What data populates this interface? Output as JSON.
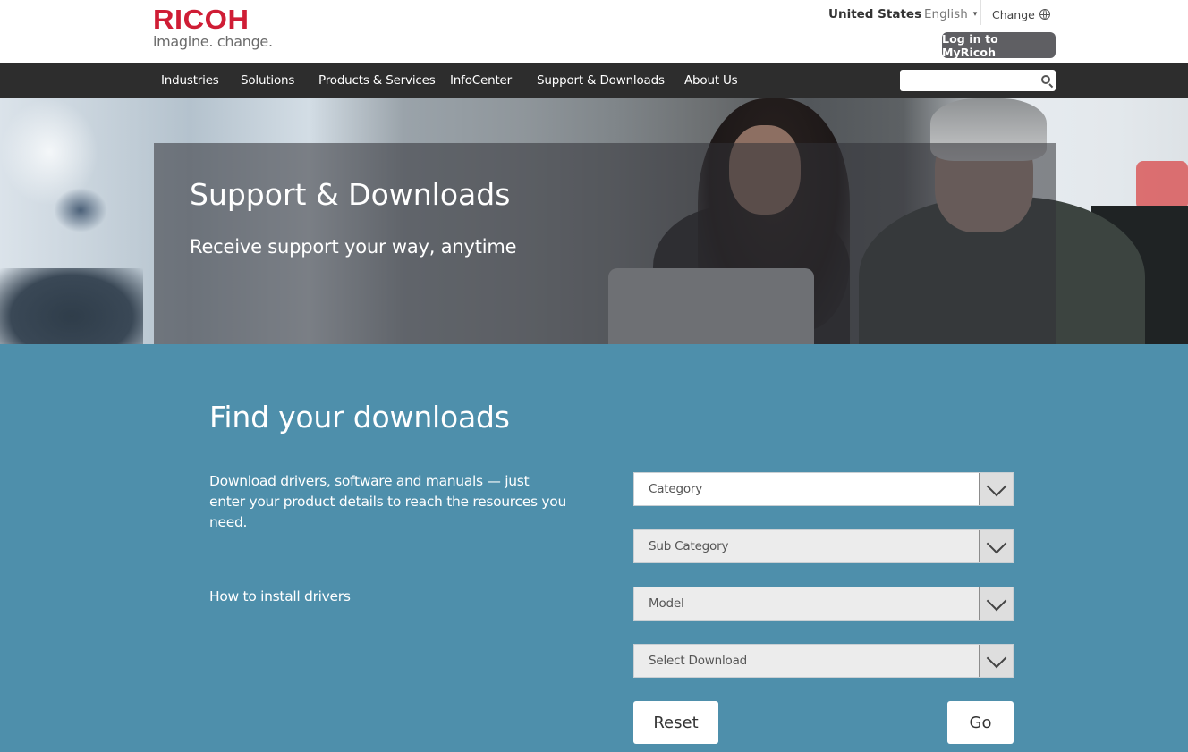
{
  "brand": {
    "name": "RICOH",
    "tagline": "imagine. change.",
    "accent_color": "#cf1d35"
  },
  "utility": {
    "country": "United States",
    "language": "English",
    "language_caret": "▾",
    "change_label": "Change",
    "login_label": "Log in to MyRicoh"
  },
  "nav": {
    "items": [
      {
        "label": "Industries"
      },
      {
        "label": "Solutions"
      },
      {
        "label": "Products & Services"
      },
      {
        "label": "InfoCenter"
      },
      {
        "label": "Support & Downloads"
      },
      {
        "label": "About Us"
      }
    ],
    "search_placeholder": ""
  },
  "hero": {
    "title": "Support & Downloads",
    "subtitle": "Receive support your way, anytime"
  },
  "finder": {
    "title": "Find your downloads",
    "description": "Download drivers, software and manuals — just enter your product details to reach the resources you need.",
    "howto_link": "How to install drivers",
    "selects": [
      {
        "label": "Category"
      },
      {
        "label": "Sub Category"
      },
      {
        "label": "Model"
      },
      {
        "label": "Select Download"
      }
    ],
    "reset_label": "Reset",
    "go_label": "Go",
    "background_color": "#4e8fab"
  }
}
